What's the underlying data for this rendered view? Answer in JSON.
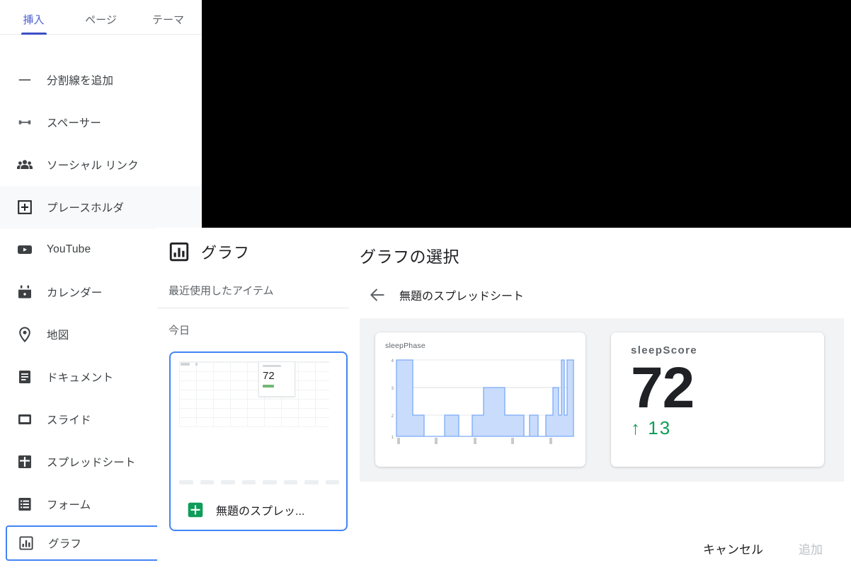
{
  "sidebar": {
    "tabs": [
      {
        "label": "挿入",
        "active": true
      },
      {
        "label": "ページ",
        "active": false
      },
      {
        "label": "テーマ",
        "active": false
      }
    ],
    "items": [
      {
        "label": "分割線を追加",
        "icon": "divider-icon"
      },
      {
        "label": "スペーサー",
        "icon": "spacer-icon"
      },
      {
        "label": "ソーシャル リンク",
        "icon": "people-icon"
      },
      {
        "label": "プレースホルダ",
        "icon": "plus-box-icon"
      },
      {
        "label": "YouTube",
        "icon": "youtube-icon"
      },
      {
        "label": "カレンダー",
        "icon": "calendar-icon"
      },
      {
        "label": "地図",
        "icon": "map-pin-icon"
      },
      {
        "label": "ドキュメント",
        "icon": "docs-icon"
      },
      {
        "label": "スライド",
        "icon": "slides-icon"
      },
      {
        "label": "スプレッドシート",
        "icon": "sheets-icon"
      },
      {
        "label": "フォーム",
        "icon": "forms-icon"
      },
      {
        "label": "グラフ",
        "icon": "chart-icon"
      }
    ]
  },
  "picker": {
    "title": "グラフ",
    "title_icon": "chart-icon",
    "recent_label": "最近使用したアイテム",
    "group_label": "今日",
    "file": {
      "name": "無題のスプレッ...",
      "icon": "google-sheets-icon",
      "thumb_value": "72"
    }
  },
  "dialog": {
    "title": "グラフの選択",
    "back_icon": "arrow-left-icon",
    "breadcrumb": "無題のスプレッドシート",
    "cards": [
      {
        "caption": "sleepPhase",
        "type": "chart"
      },
      {
        "caption": "sleepScore",
        "value": "72",
        "delta": "13",
        "delta_icon": "arrow-up-icon",
        "delta_color": "#0f9d58"
      }
    ],
    "buttons": {
      "cancel": "キャンセル",
      "add": "追加",
      "add_disabled": true
    }
  },
  "colors": {
    "accent": "#4285f4",
    "tab_active": "#3c4fc4",
    "positive": "#0f9d58",
    "panel_bg": "#f1f3f4",
    "chart_fill": "#c6dafc",
    "chart_stroke": "#7baaf7"
  },
  "chart_data": {
    "type": "area",
    "title": "sleepPhase",
    "xlabel": "",
    "ylabel": "",
    "ylim": [
      1,
      4
    ],
    "yticks": [
      1,
      2,
      3,
      4
    ],
    "grid": true,
    "legend": "none",
    "step": "post",
    "x": [
      0,
      1,
      2,
      3,
      4,
      5,
      6,
      7,
      8,
      9,
      10,
      11,
      12,
      13,
      14,
      15,
      16,
      17,
      18,
      19,
      20,
      21,
      22,
      23,
      24,
      25,
      26,
      27,
      28,
      29,
      30,
      31
    ],
    "values": [
      4,
      4,
      2,
      2,
      1,
      1,
      2,
      2,
      1,
      1,
      2,
      2,
      3,
      3,
      3,
      2,
      2,
      2,
      1,
      2,
      2,
      1,
      1,
      2,
      3,
      3,
      2,
      4,
      2,
      4,
      4,
      2
    ],
    "xtick_positions": [
      0,
      6,
      13,
      19,
      25
    ],
    "xtick_labels": [
      "",
      "",
      "",
      "",
      ""
    ]
  }
}
